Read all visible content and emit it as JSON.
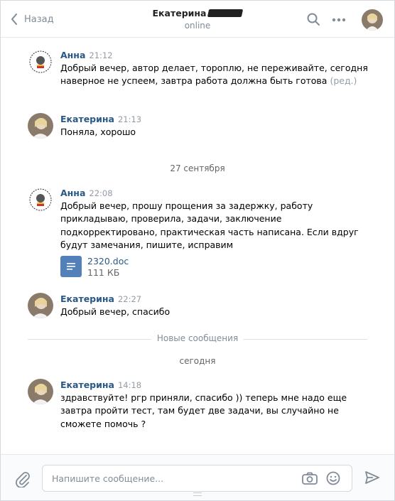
{
  "header": {
    "back_label": "Назад",
    "title": "Екатерина",
    "status": "online"
  },
  "colors": {
    "link": "#2a5885",
    "icon": "#818c99",
    "doc_icon": "#5181b8"
  },
  "messages": [
    {
      "author": "Анна",
      "time": "21:12",
      "text": "Добрый вечер, автор делает, тороплю, не переживайте, сегодня наверное не успеем, завтра работа должна быть готова",
      "edited": "(ред.)",
      "avatar": "logo-avatar"
    },
    {
      "author": "Екатерина",
      "time": "21:13",
      "text": "Поняла, хорошо",
      "avatar": "photo-avatar"
    },
    {
      "author": "Анна",
      "time": "22:08",
      "text": "Добрый вечер, прошу прощения за задержку, работу прикладываю, проверила, задачи, заключение подкорректировано, практическая часть написана. Если вдруг будут замечания, пишите, исправим",
      "attachment": {
        "name": "2320.doc",
        "size": "111 КБ",
        "icon": "document-icon"
      },
      "avatar": "logo-avatar"
    },
    {
      "author": "Екатерина",
      "time": "22:27",
      "text": "Добрый вечер, спасибо",
      "avatar": "photo-avatar"
    },
    {
      "author": "Екатерина",
      "time": "14:18",
      "text": "здравствуйте! ргр приняли, спасибо )) теперь мне надо еще завтра пройти тест, там будет две задачи, вы случайно не сможете помочь ?",
      "avatar": "photo-avatar"
    }
  ],
  "separators": {
    "date_1": "27 сентября",
    "new_messages": "Новые сообщения",
    "date_2": "сегодня"
  },
  "composer": {
    "placeholder": "Напишите сообщение..."
  }
}
